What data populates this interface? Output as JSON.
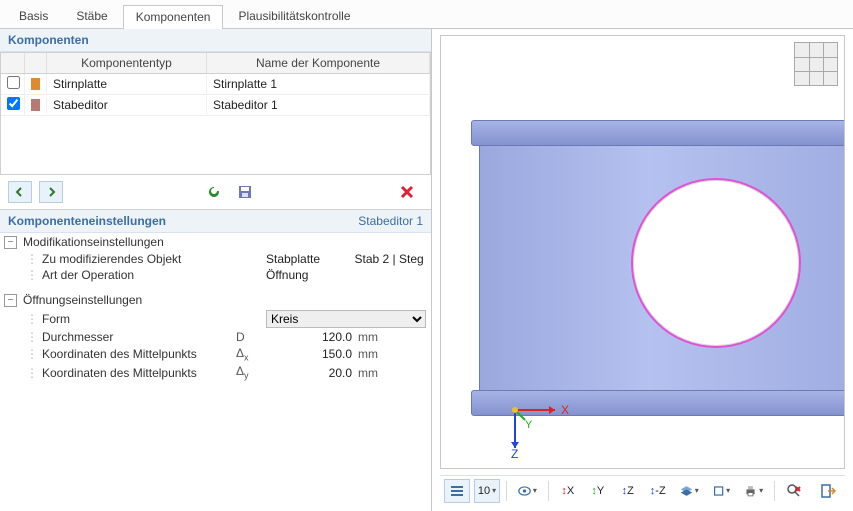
{
  "tabs": [
    "Basis",
    "Stäbe",
    "Komponenten",
    "Plausibilitätskontrolle"
  ],
  "active_tab_index": 2,
  "components": {
    "title": "Komponenten",
    "columns": {
      "type": "Komponententyp",
      "name": "Name der Komponente"
    },
    "rows": [
      {
        "checked": false,
        "swatch": "#e08a2e",
        "type": "Stirnplatte",
        "name": "Stirnplatte 1"
      },
      {
        "checked": true,
        "swatch": "#b57a72",
        "type": "Stabeditor",
        "name": "Stabeditor 1"
      }
    ]
  },
  "settings": {
    "label": "Komponenteneinstellungen",
    "subject": "Stabeditor 1",
    "groups": [
      {
        "title": "Modifikationseinstellungen",
        "rows": [
          {
            "label": "Zu modifizierendes Objekt",
            "value_text": "Stabplatte",
            "extra": "Stab 2 | Steg"
          },
          {
            "label": "Art der Operation",
            "value_text": "Öffnung"
          }
        ]
      },
      {
        "title": "Öffnungseinstellungen",
        "rows": [
          {
            "label": "Form",
            "control": "select",
            "value_text": "Kreis"
          },
          {
            "label": "Durchmesser",
            "symbol": "D",
            "value": "120.0",
            "unit": "mm"
          },
          {
            "label": "Koordinaten des Mittelpunkts",
            "symbol": "Δx",
            "value": "150.0",
            "unit": "mm"
          },
          {
            "label": "Koordinaten des Mittelpunkts",
            "symbol": "Δy",
            "value": "20.0",
            "unit": "mm"
          }
        ]
      }
    ]
  },
  "viewport": {
    "axes": {
      "x": "X",
      "y": "Y",
      "z": "Z"
    },
    "toolbar_note": "10"
  },
  "colors": {
    "brand": "#3a6ea5",
    "hole_outline": "#e052d6",
    "beam": "#9aa8de"
  }
}
